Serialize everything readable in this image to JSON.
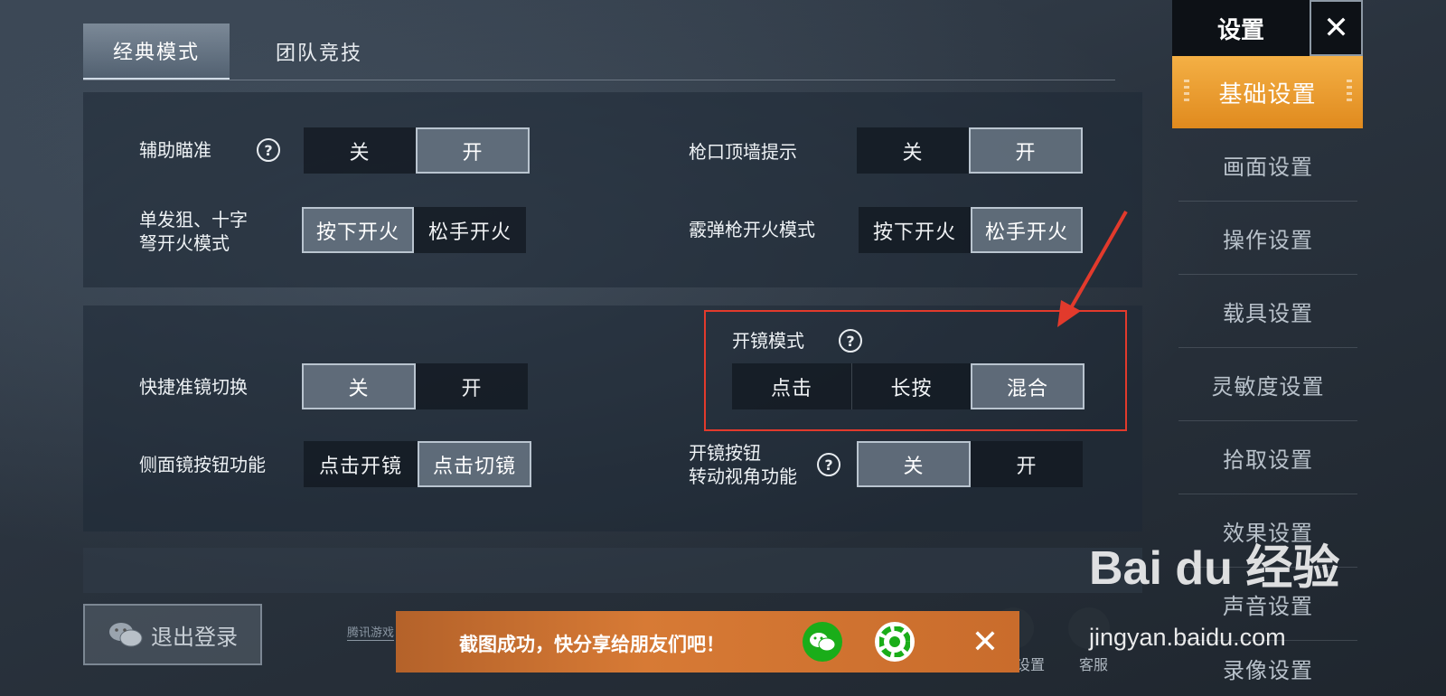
{
  "tabs": [
    {
      "label": "经典模式",
      "active": true
    },
    {
      "label": "团队竞技",
      "active": false
    }
  ],
  "panel1": {
    "aim_assist": {
      "label": "辅助瞄准",
      "options": [
        "关",
        "开"
      ],
      "selected": "开"
    },
    "muzzle_wall": {
      "label": "枪口顶墙提示",
      "options": [
        "关",
        "开"
      ],
      "selected": "开"
    },
    "sniper_fire": {
      "label_line1": "单发狙、十字",
      "label_line2": "弩开火模式",
      "options": [
        "按下开火",
        "松手开火"
      ],
      "selected": "按下开火"
    },
    "shotgun_fire": {
      "label": "霰弹枪开火模式",
      "options": [
        "按下开火",
        "松手开火"
      ],
      "selected": "松手开火"
    }
  },
  "panel2": {
    "quick_scope": {
      "label": "快捷准镜切换",
      "options": [
        "关",
        "开"
      ],
      "selected": "关"
    },
    "scope_mode": {
      "label": "开镜模式",
      "options": [
        "点击",
        "长按",
        "混合"
      ],
      "selected": "混合"
    },
    "side_scope": {
      "label": "侧面镜按钮功能",
      "options": [
        "点击开镜",
        "点击切镜"
      ],
      "selected": "点击切镜"
    },
    "scope_rotate": {
      "label_line1": "开镜按钮",
      "label_line2": "转动视角功能",
      "options": [
        "关",
        "开"
      ],
      "selected": "关"
    }
  },
  "sidebar": {
    "title": "设置",
    "close_label": "✕",
    "items": [
      "基础设置",
      "画面设置",
      "操作设置",
      "载具设置",
      "灵敏度设置",
      "拾取设置",
      "效果设置",
      "声音设置",
      "录像设置"
    ],
    "active_index": 0
  },
  "bottom": {
    "logout_label": "退出登录",
    "tencent_text": "腾讯游戏",
    "settings_label": "设置",
    "service_label": "客服"
  },
  "share_bar": {
    "message": "截图成功，快分享给朋友们吧！",
    "close_label": "✕"
  },
  "watermark": {
    "logo": "Bai du 经验",
    "url": "jingyan.baidu.com"
  },
  "colors": {
    "accent_orange": "#e8962c",
    "annotation_red": "#e23a2c",
    "wechat_green": "#1aad19"
  },
  "icons": [
    "help-icon",
    "close-icon",
    "wechat-icon",
    "moments-icon",
    "arrow-annotation"
  ]
}
